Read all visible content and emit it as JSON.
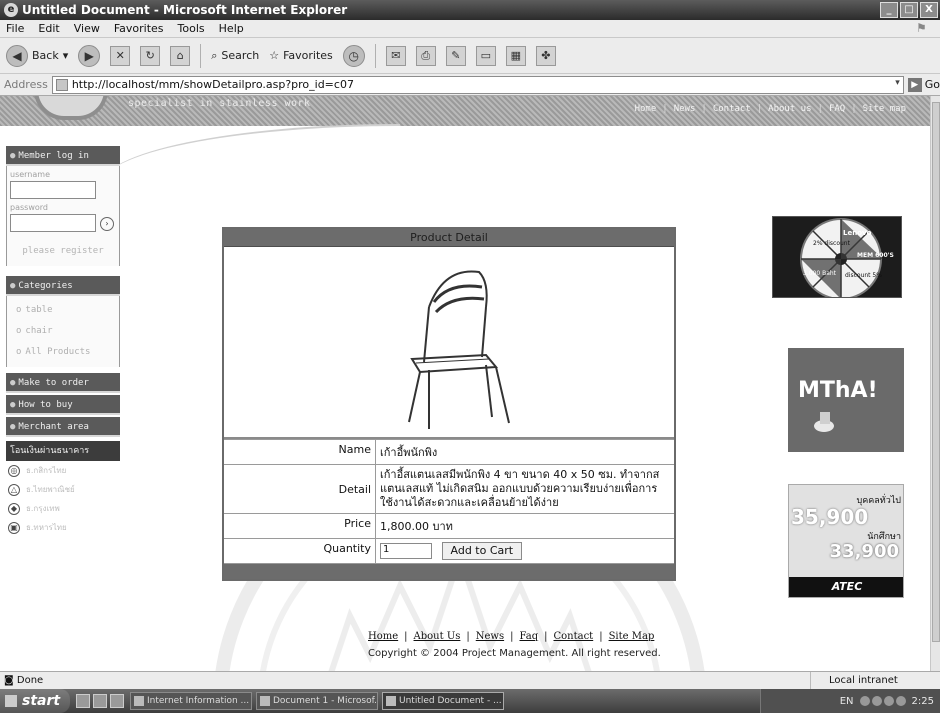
{
  "window": {
    "title": "Untitled Document - Microsoft Internet Explorer",
    "controls": [
      "_",
      "□",
      "X"
    ]
  },
  "menu": [
    "File",
    "Edit",
    "View",
    "Favorites",
    "Tools",
    "Help"
  ],
  "toolbar": {
    "back": "Back",
    "search": "Search",
    "favorites": "Favorites"
  },
  "address": {
    "label": "Address",
    "url": "http://localhost/mm/showDetailpro.asp?pro_id=c07",
    "go": "Go"
  },
  "site": {
    "tagline": "specialist in stainless work",
    "nav": [
      "Home",
      "News",
      "Contact",
      "About us",
      "FAQ",
      "Site map"
    ]
  },
  "sidebar": {
    "member_heading": "Member log in",
    "username_label": "username",
    "password_label": "password",
    "register": "please register",
    "categories_heading": "Categories",
    "categories": [
      "table",
      "chair",
      "All Products"
    ],
    "make_to_order": "Make to order",
    "how_to_buy": "How to buy",
    "merchant_area": "Merchant area",
    "payment_heading": "โอนเงินผ่านธนาคาร",
    "banks": [
      "ธ.กสิกรไทย",
      "ธ.ไทยพาณิชย์",
      "ธ.กรุงเทพ",
      "ธ.ทหารไทย"
    ]
  },
  "product": {
    "heading": "Product Detail",
    "name_label": "Name",
    "name_value": "เก้าอี้พนักพิง",
    "detail_label": "Detail",
    "detail_value": "เก้าอี้สแตนเลสมีพนักพิง 4 ขา ขนาด 40 x 50 ซม. ทำจากสแตนเลสแท้ ไม่เกิดสนิม ออกแบบด้วยความเรียบง่ายเพื่อการใช้งานได้สะดวกและเคลื่อนย้ายได้ง่าย",
    "price_label": "Price",
    "price_value": "1,800.00 บาท",
    "quantity_label": "Quantity",
    "quantity_value": "1",
    "add_to_cart": "Add to Cart"
  },
  "banners": {
    "wheel_texts": [
      "2% discount",
      "Lenovo",
      "3,000 Baht",
      "MEM 600'S",
      "discount 5%"
    ],
    "mthai": "MThA!",
    "atec": {
      "line1": "บุคคลทั่วไป",
      "price1": "35,900",
      "line2": "นักศึกษา",
      "price2": "33,900",
      "brand": "ATEC"
    }
  },
  "footer": {
    "links": [
      "Home",
      "About Us",
      "News",
      "Faq",
      "Contact",
      "Site Map"
    ],
    "copyright": "Copyright © 2004 Project Management. All right reserved."
  },
  "status": {
    "left": "Done",
    "zone": "Local intranet"
  },
  "taskbar": {
    "start": "start",
    "tasks": [
      "Internet Information ...",
      "Document 1 - Microsof...",
      "Untitled Document - ..."
    ],
    "lang": "EN",
    "clock": "2:25"
  }
}
